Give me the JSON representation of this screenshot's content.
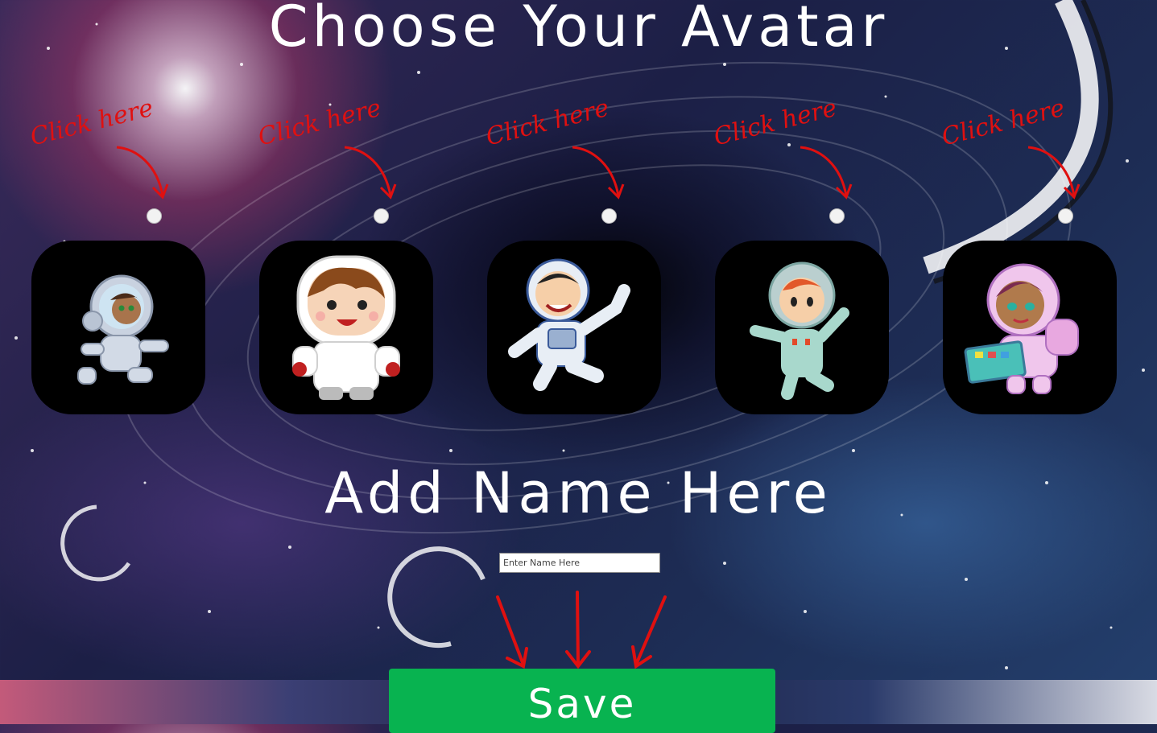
{
  "page": {
    "title": "Choose Your Avatar",
    "name_heading": "Add Name Here"
  },
  "avatars": [
    {
      "hint": "Click here",
      "icon": "astronaut-girl-running-icon"
    },
    {
      "hint": "Click here",
      "icon": "astronaut-boy-white-suit-icon"
    },
    {
      "hint": "Click here",
      "icon": "astronaut-boy-waving-icon"
    },
    {
      "hint": "Click here",
      "icon": "astronaut-kid-mint-suit-icon"
    },
    {
      "hint": "Click here",
      "icon": "astronaut-girl-pink-tablet-icon"
    }
  ],
  "name_input": {
    "placeholder": "Enter Name Here",
    "value": ""
  },
  "save_button": {
    "label": "Save"
  },
  "colors": {
    "hint_red": "#e01010",
    "save_green": "#08b350",
    "tile_black": "#000000",
    "title_white": "#ffffff"
  }
}
